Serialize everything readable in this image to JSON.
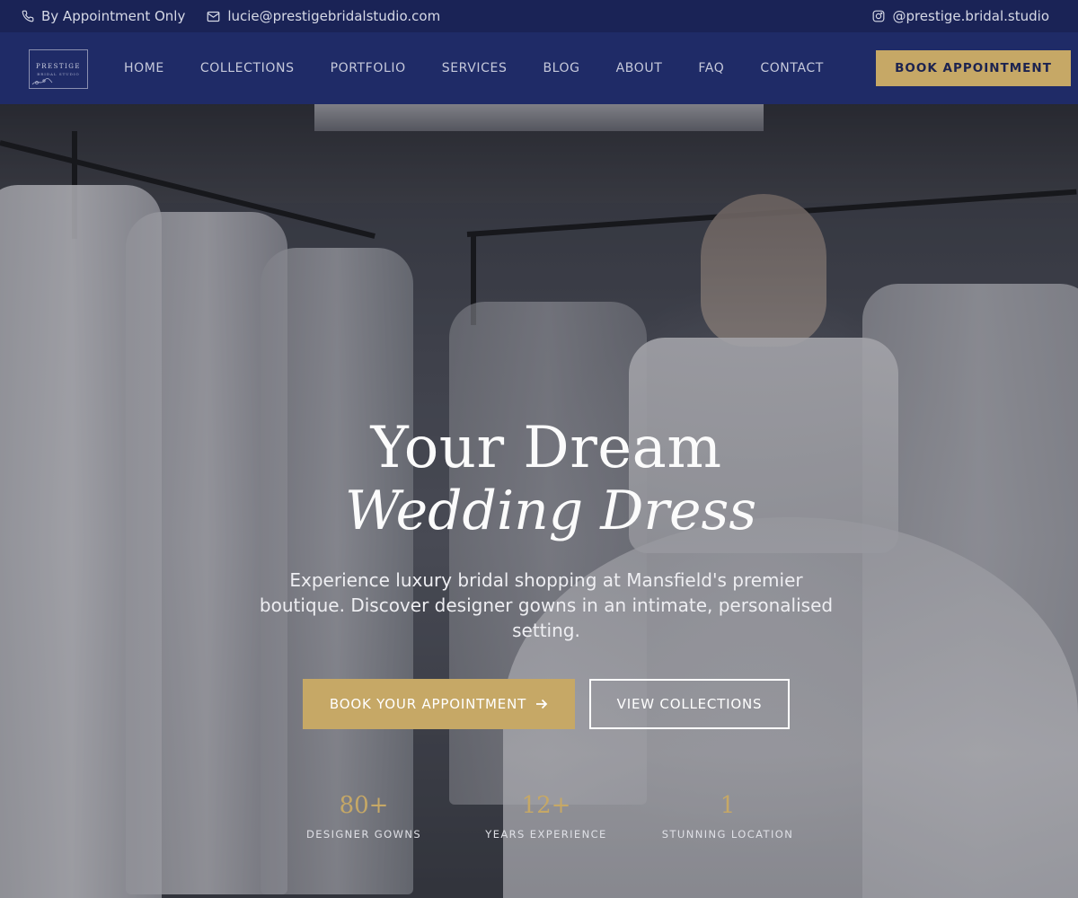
{
  "topbar": {
    "appointment_text": "By Appointment Only",
    "email": "lucie@prestigebridalstudio.com",
    "instagram": "@prestige.bridal.studio"
  },
  "logo": {
    "line1": "PRESTIGE",
    "line2": "BRIDAL STUDIO"
  },
  "nav": {
    "items": [
      {
        "label": "HOME"
      },
      {
        "label": "COLLECTIONS"
      },
      {
        "label": "PORTFOLIO"
      },
      {
        "label": "SERVICES"
      },
      {
        "label": "BLOG"
      },
      {
        "label": "ABOUT"
      },
      {
        "label": "FAQ"
      },
      {
        "label": "CONTACT"
      }
    ],
    "cta_label": "BOOK APPOINTMENT"
  },
  "hero": {
    "title_line1": "Your Dream",
    "title_line2": "Wedding Dress",
    "subtitle": "Experience luxury bridal shopping at Mansfield's premier boutique. Discover designer gowns in an intimate, personalised setting.",
    "primary_button": "BOOK YOUR APPOINTMENT",
    "secondary_button": "VIEW COLLECTIONS",
    "stats": [
      {
        "value": "80+",
        "label": "DESIGNER GOWNS"
      },
      {
        "value": "12+",
        "label": "YEARS EXPERIENCE"
      },
      {
        "value": "1",
        "label": "STUNNING LOCATION"
      }
    ]
  },
  "colors": {
    "navy": "#1f2b67",
    "gold": "#c6a866"
  },
  "icons": [
    "phone-icon",
    "mail-icon",
    "instagram-icon",
    "arrow-right-icon"
  ]
}
